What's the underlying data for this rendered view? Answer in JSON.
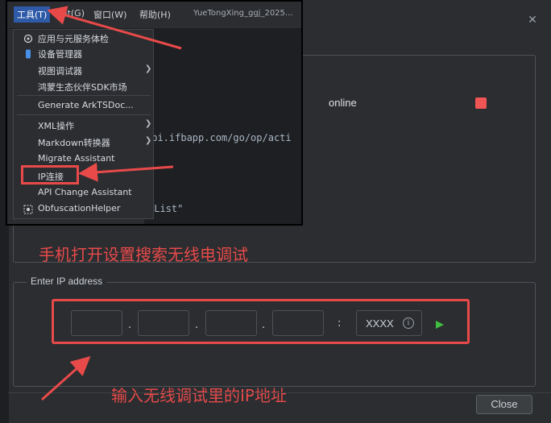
{
  "menubar": {
    "items": [
      "工具(T)",
      "Git(G)",
      "窗口(W)",
      "帮助(H)"
    ],
    "project_title": "YueTongXing_ggj_2025..."
  },
  "editor": {
    "lines": [
      "api.ifbapp.com/go/op/acti",
      "{",
      "dList\""
    ]
  },
  "dropdown": {
    "items": [
      {
        "label": "应用与元服务体检",
        "submenu": false
      },
      {
        "label": "设备管理器",
        "submenu": false
      },
      {
        "label": "视图调试器",
        "submenu": true
      },
      {
        "label": "鸿蒙生态伙伴SDK市场",
        "submenu": false
      },
      {
        "label": "Generate ArkTSDoc...",
        "submenu": false
      },
      {
        "label": "XML操作",
        "submenu": true
      },
      {
        "label": "Markdown转换器",
        "submenu": true
      },
      {
        "label": "Migrate Assistant",
        "submenu": false
      },
      {
        "label": "IP连接",
        "submenu": false
      },
      {
        "label": "API Change Assistant",
        "submenu": false
      },
      {
        "label": "ObfuscationHelper",
        "submenu": false
      }
    ]
  },
  "dialog": {
    "status": "online",
    "status_color": "#f05555",
    "ip_section_label": "Enter IP address",
    "ip_separator": ".",
    "port_separator": ":",
    "port_placeholder": "XXXX",
    "close_label": "Close"
  },
  "annotations": {
    "hint_top": "手机打开设置搜索无线电调试",
    "hint_bottom": "输入无线调试里的IP地址",
    "color": "#e84a4a"
  }
}
